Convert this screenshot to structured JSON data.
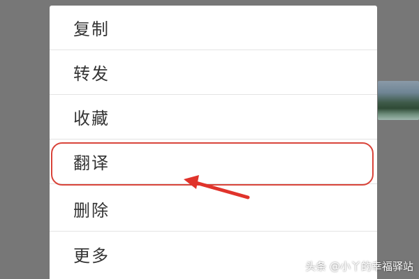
{
  "menu": {
    "items": [
      {
        "label": "复制"
      },
      {
        "label": "转发"
      },
      {
        "label": "收藏"
      },
      {
        "label": "翻译"
      },
      {
        "label": "删除"
      },
      {
        "label": "更多"
      }
    ],
    "highlighted_index": 3
  },
  "annotation": {
    "highlight_color": "#d9443a",
    "arrow_icon": "red-arrow-icon"
  },
  "watermark": {
    "text": "头条 @小丫的幸福驿站"
  }
}
